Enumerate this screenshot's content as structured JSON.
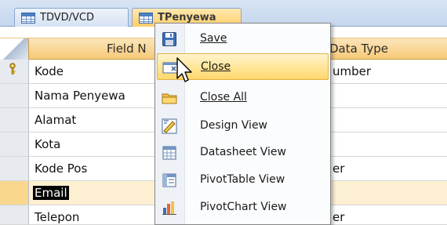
{
  "tabs": [
    {
      "label": "TDVD/VCD",
      "active": false
    },
    {
      "label": "TPenyewa",
      "active": true
    }
  ],
  "grid": {
    "headers": {
      "field_name": "Field N",
      "data_type": "Data Type"
    },
    "rows": [
      {
        "name": "Kode",
        "type": "umber",
        "primary_key": true
      },
      {
        "name": "Nama Penyewa",
        "type": ""
      },
      {
        "name": "Alamat",
        "type": ""
      },
      {
        "name": "Kota",
        "type": ""
      },
      {
        "name": "Kode Pos",
        "type": "er"
      },
      {
        "name": "Email",
        "type": "",
        "selected": true
      },
      {
        "name": "Telepon",
        "type": "er"
      }
    ]
  },
  "context_menu": {
    "items": [
      {
        "label": "Save",
        "icon": "save-icon",
        "accel": "S"
      },
      {
        "label": "Close",
        "icon": "close-window-icon",
        "accel": "C",
        "highlighted": true
      },
      {
        "label": "Close All",
        "icon": "folder-icon",
        "accel": "C"
      },
      {
        "label": "Design View",
        "icon": "design-view-icon",
        "accel": "D"
      },
      {
        "label": "Datasheet View",
        "icon": "datasheet-view-icon",
        "accel": "h"
      },
      {
        "label": "PivotTable View",
        "icon": "pivottable-view-icon",
        "accel": "o"
      },
      {
        "label": "PivotChart View",
        "icon": "pivotchart-view-icon",
        "accel": "v"
      }
    ]
  },
  "colors": {
    "accent": "#ffd86a",
    "tab_active": "#ffce68",
    "header": "#f7c977"
  }
}
